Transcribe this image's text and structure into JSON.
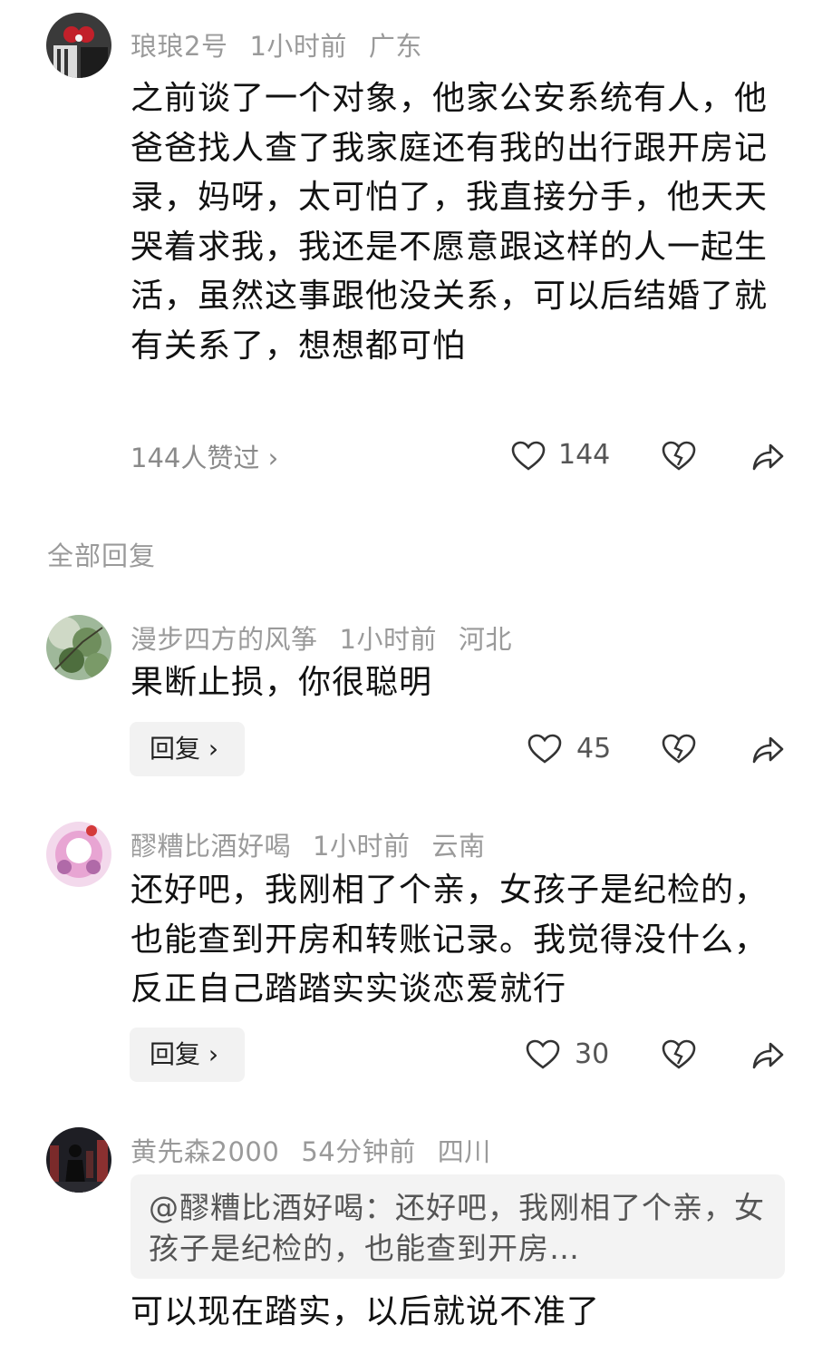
{
  "main_comment": {
    "username": "琅琅2号",
    "time": "1小时前",
    "location": "广东",
    "text": "之前谈了一个对象，他家公安系统有人，他爸爸找人查了我家庭还有我的出行跟开房记录，妈呀，太可怕了，我直接分手，他天天哭着求我，我还是不愿意跟这样的人一起生活，虽然这事跟他没关系，可以后结婚了就有关系了，想想都可怕",
    "likes_link": "144人赞过 ›",
    "like_count": "144"
  },
  "section_title": "全部回复",
  "replies": [
    {
      "username": "漫步四方的风筝",
      "time": "1小时前",
      "location": "河北",
      "text": "果断止损，你很聪明",
      "reply_label": "回复 ›",
      "like_count": "45"
    },
    {
      "username": "醪糟比酒好喝",
      "time": "1小时前",
      "location": "云南",
      "text": "还好吧，我刚相了个亲，女孩子是纪检的，也能查到开房和转账记录。我觉得没什么，反正自己踏踏实实谈恋爱就行",
      "reply_label": "回复 ›",
      "like_count": "30"
    },
    {
      "username": "黄先森2000",
      "time": "54分钟前",
      "location": "四川",
      "quote": "@醪糟比酒好喝：还好吧，我刚相了个亲，女孩子是纪检的，也能查到开房…",
      "text": "可以现在踏实，以后就说不准了"
    }
  ],
  "icons": {
    "like": "heart-outline-icon",
    "dislike": "broken-heart-icon",
    "share": "share-arrow-icon"
  },
  "colors": {
    "meta_text": "#9a9a9a",
    "body_text": "#111111",
    "reply_button_bg": "#f2f2f2",
    "quote_bg": "#f3f3f3"
  }
}
